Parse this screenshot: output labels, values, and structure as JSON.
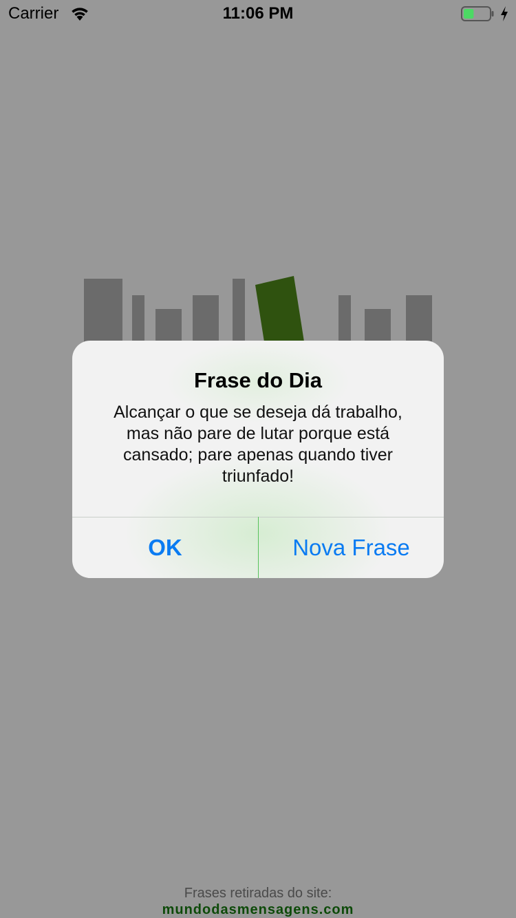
{
  "status_bar": {
    "carrier": "Carrier",
    "time": "11:06 PM",
    "battery_level": 0.4,
    "battery_color": "#4cd964",
    "charging": true
  },
  "colors": {
    "overlay_background": "#989898",
    "book_grey": "#6b6b6b",
    "book_accent": "#2f520f",
    "link_color": "#0d4a09",
    "button_color": "#0a7bf2"
  },
  "alert": {
    "title": "Frase do Dia",
    "message_lines": [
      "Alcançar o que se deseja dá trabalho,",
      "mas não pare de lutar porque está",
      "cansado; pare apenas quando tiver",
      "triunfado!"
    ],
    "buttons": {
      "ok": "OK",
      "new_quote": "Nova Frase"
    }
  },
  "footer": {
    "caption": "Frases retiradas do site:",
    "site": "mundodasmensagens.com"
  },
  "icons": {
    "wifi": "wifi-icon",
    "battery": "battery-icon",
    "charging": "charging-bolt-icon",
    "logo": "books-logo"
  }
}
